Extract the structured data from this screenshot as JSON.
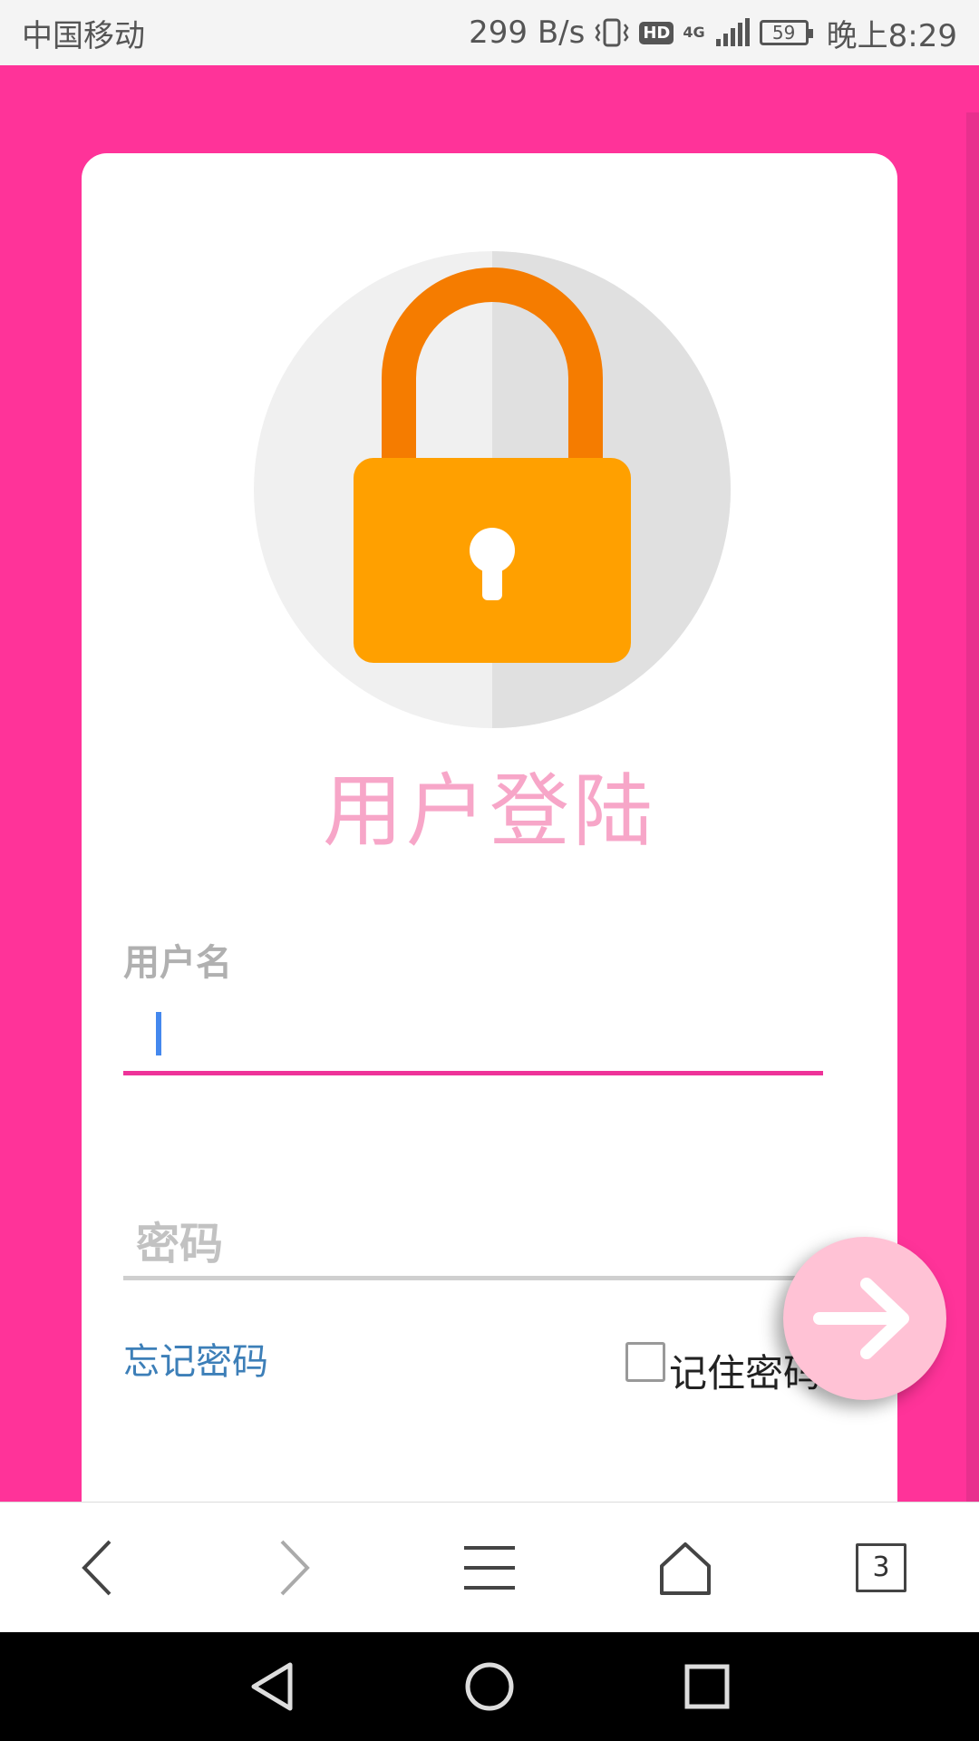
{
  "status_bar": {
    "carrier": "中国移动",
    "net_speed": "299 B/s",
    "hd_badge": "HD",
    "network_type": "4G",
    "battery_level": "59",
    "time": "晚上8:29"
  },
  "login": {
    "title": "用户登陆",
    "username_label": "用户名",
    "username_value": "",
    "password_placeholder": "密码",
    "forgot_password": "忘记密码",
    "remember_password": "记住密码",
    "remember_checked": false
  },
  "browser_toolbar": {
    "tab_count": "3"
  },
  "colors": {
    "page_background": "#ff3399",
    "title": "#f7a6c8",
    "active_underline": "#ee3399",
    "link": "#3d7fb8",
    "lock_body": "#ffa000",
    "lock_shackle": "#f57c00",
    "fab": "#ffc2d5"
  },
  "icons": {
    "signal": "signal-bars-icon",
    "vibrate": "vibrate-icon",
    "lock": "padlock-icon",
    "fab": "arrow-right-icon",
    "back": "chevron-left-icon",
    "forward": "chevron-right-icon",
    "menu": "hamburger-menu-icon",
    "home": "home-icon",
    "nav_back": "triangle-back-icon",
    "nav_home": "circle-home-icon",
    "nav_recent": "square-recent-icon"
  }
}
